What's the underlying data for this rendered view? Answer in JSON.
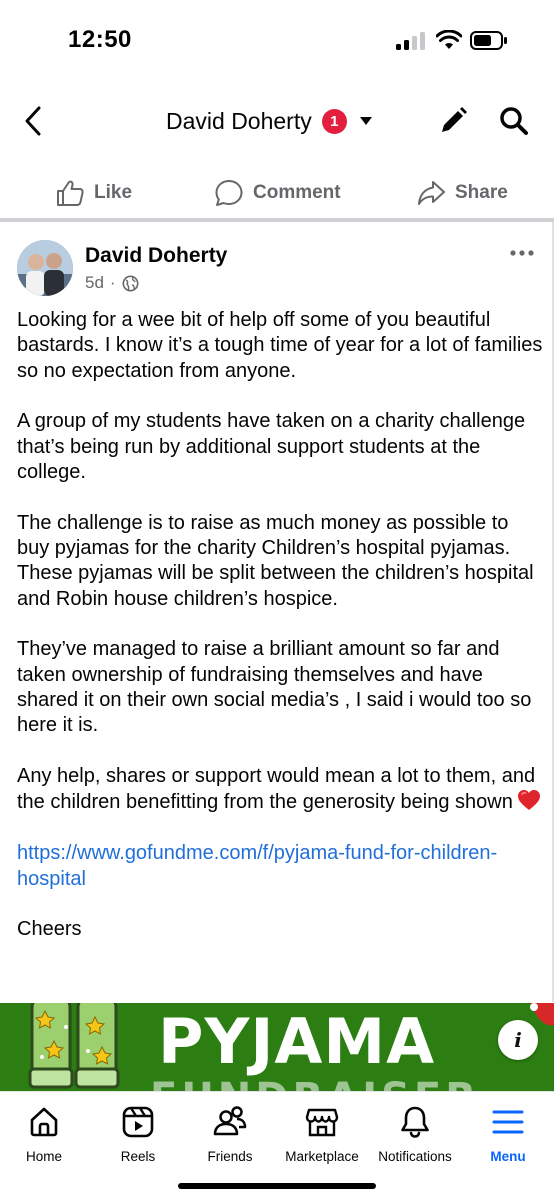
{
  "status_bar": {
    "time": "12:50"
  },
  "header": {
    "title": "David Doherty",
    "badge_count": "1",
    "icons": [
      "back-icon",
      "caret-down-icon",
      "edit-icon",
      "search-icon"
    ]
  },
  "actions": {
    "like": "Like",
    "comment": "Comment",
    "share": "Share"
  },
  "post": {
    "author": "David Doherty",
    "time": "5d",
    "dot": "·",
    "privacy_icon": "globe-icon",
    "paragraphs": [
      "Looking for a wee bit of help off some of you beautiful bastards.  I know it’s a tough time of year for a lot of families so no expectation from anyone.",
      "A group of my students have taken on a charity challenge that’s being run by additional support students at the college.",
      "The challenge is to raise as much money as possible to buy pyjamas for the charity Children’s hospital pyjamas.  These pyjamas will be split between the children’s hospital and Robin house children’s hospice.",
      "They’ve managed to raise a brilliant amount so far and taken ownership of fundraising themselves and have shared it on their own social media’s , I said i would too so here it is.",
      "Any help, shares or support would mean a lot to them, and the children benefitting from the generosity being shown"
    ],
    "link": "https://www.gofundme.com/f/pyjama-fund-for-children-hospital",
    "signoff": "Cheers"
  },
  "banner": {
    "title": "PYJAMA",
    "subtitle": "FUNDRAISER",
    "info": "i"
  },
  "tabs": [
    {
      "label": "Home",
      "icon": "home-icon"
    },
    {
      "label": "Reels",
      "icon": "reels-icon"
    },
    {
      "label": "Friends",
      "icon": "friends-icon"
    },
    {
      "label": "Marketplace",
      "icon": "marketplace-icon"
    },
    {
      "label": "Notifications",
      "icon": "bell-icon"
    },
    {
      "label": "Menu",
      "icon": "menu-icon",
      "active": true
    }
  ],
  "colors": {
    "accent": "#0866ff",
    "link": "#216fdb",
    "badge": "#e41e3f",
    "banner": "#2c7d12",
    "muted": "#65676b"
  }
}
